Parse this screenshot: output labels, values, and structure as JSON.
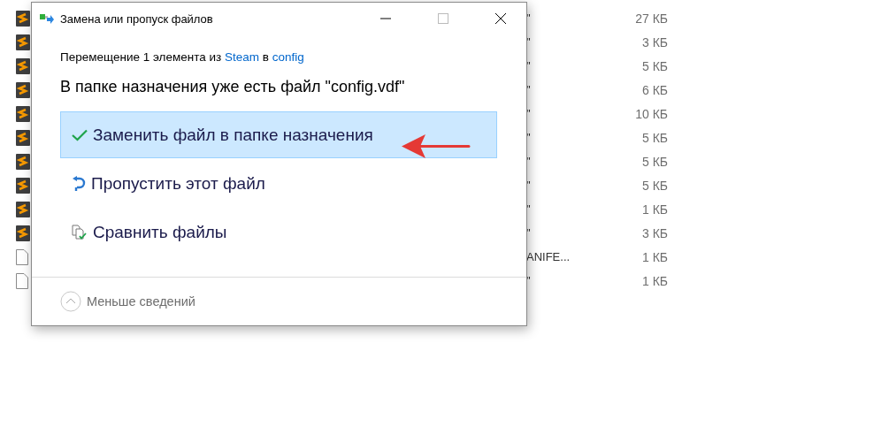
{
  "background_files": [
    {
      "kind": "sublime",
      "name": "\"",
      "size": "27 КБ"
    },
    {
      "kind": "sublime",
      "name": "\"",
      "size": "3 КБ"
    },
    {
      "kind": "sublime",
      "name": "\"",
      "size": "5 КБ"
    },
    {
      "kind": "sublime",
      "name": "\"",
      "size": "6 КБ"
    },
    {
      "kind": "sublime",
      "name": "\"",
      "size": "10 КБ"
    },
    {
      "kind": "sublime",
      "name": "\"",
      "size": "5 КБ"
    },
    {
      "kind": "sublime",
      "name": "\"",
      "size": "5 КБ"
    },
    {
      "kind": "sublime",
      "name": "\"",
      "size": "5 КБ"
    },
    {
      "kind": "sublime",
      "name": "\"",
      "size": "1 КБ"
    },
    {
      "kind": "sublime",
      "name": "\"",
      "size": "3 КБ"
    },
    {
      "kind": "blank",
      "name": "ANIFE...",
      "size": "1 КБ"
    },
    {
      "kind": "blank",
      "name": "\"",
      "size": "1 КБ"
    }
  ],
  "dialog": {
    "title": "Замена или пропуск файлов",
    "summary": {
      "prefix": "Перемещение 1 элемента из",
      "source": "Steam",
      "middle": "в",
      "destination": "config"
    },
    "heading": "В папке назначения уже есть файл \"config.vdf\"",
    "options": [
      {
        "kind": "replace",
        "label": "Заменить файл в папке назначения",
        "selected": true
      },
      {
        "kind": "skip",
        "label": "Пропустить этот файл",
        "selected": false
      },
      {
        "kind": "compare",
        "label": "Сравнить файлы",
        "selected": false
      }
    ],
    "details_toggle": "Меньше сведений"
  }
}
